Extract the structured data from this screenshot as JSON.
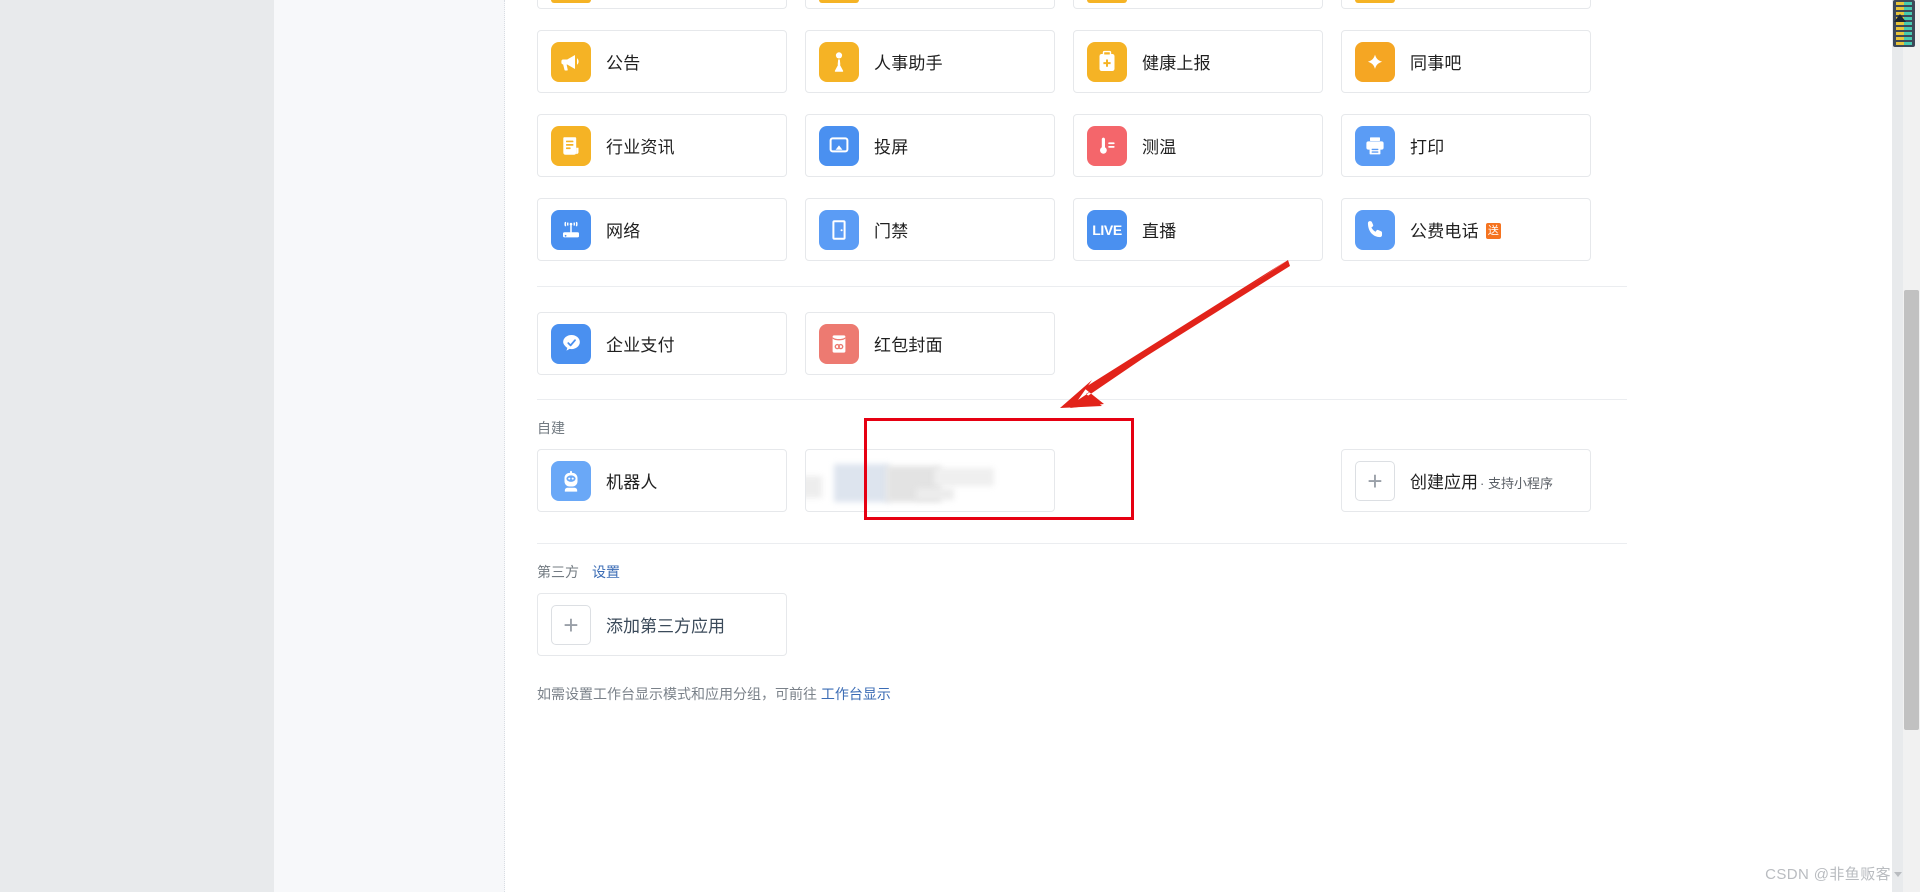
{
  "apps": {
    "partial_top_row": [
      {
        "id": "stub-1",
        "color": "#f5b325"
      },
      {
        "id": "stub-2",
        "color": "#f5b325"
      },
      {
        "id": "stub-3",
        "color": "#f5b325"
      },
      {
        "id": "stub-4",
        "color": "#f5b325"
      }
    ],
    "grid_rows": [
      [
        {
          "label": "公告",
          "icon": "megaphone-icon",
          "color": "#f5b325",
          "badge": ""
        },
        {
          "label": "人事助手",
          "icon": "person-icon",
          "color": "#f5b325",
          "badge": ""
        },
        {
          "label": "健康上报",
          "icon": "clipboard-plus-icon",
          "color": "#f5b325",
          "badge": ""
        },
        {
          "label": "同事吧",
          "icon": "clover-icon",
          "color": "#f5a623",
          "badge": ""
        }
      ],
      [
        {
          "label": "行业资讯",
          "icon": "news-icon",
          "color": "#f5b325",
          "badge": ""
        },
        {
          "label": "投屏",
          "icon": "airplay-icon",
          "color": "#4a90f0",
          "badge": ""
        },
        {
          "label": "测温",
          "icon": "thermometer-icon",
          "color": "#f4666b",
          "badge": ""
        },
        {
          "label": "打印",
          "icon": "printer-icon",
          "color": "#5b9cf5",
          "badge": ""
        }
      ],
      [
        {
          "label": "网络",
          "icon": "router-wifi-icon",
          "color": "#4a90f0",
          "badge": ""
        },
        {
          "label": "门禁",
          "icon": "door-icon",
          "color": "#5b9cf5",
          "badge": ""
        },
        {
          "label": "直播",
          "icon": "live-text-icon",
          "color": "#4a90f0",
          "badge": ""
        },
        {
          "label": "公费电话",
          "icon": "phone-icon",
          "color": "#5b9cf5",
          "badge": "送"
        }
      ]
    ],
    "pay_row": [
      {
        "label": "企业支付",
        "icon": "wechat-pay-icon",
        "color": "#4a90f0",
        "badge": ""
      },
      {
        "label": "红包封面",
        "icon": "red-packet-icon",
        "color": "#ed7a71",
        "badge": ""
      }
    ]
  },
  "self_built": {
    "section_title": "自建",
    "robot": {
      "label": "机器人",
      "icon": "robot-icon",
      "color": "#6aa8f7"
    },
    "hidden_app": {
      "label": ""
    },
    "create": {
      "label": "创建应用",
      "sub": "· 支持小程序",
      "icon": "plus-icon"
    }
  },
  "third_party": {
    "section_title": "第三方",
    "settings_link": "设置",
    "add_label": "添加第三方应用",
    "add_icon": "plus-icon"
  },
  "footer": {
    "text_before": "如需设置工作台显示模式和应用分组，可前往",
    "link": "工作台显示"
  },
  "annotations": {
    "highlight_color": "#e60012",
    "arrow_color": "#e2231a"
  },
  "watermark": {
    "text": "CSDN @非鱼贩客"
  }
}
